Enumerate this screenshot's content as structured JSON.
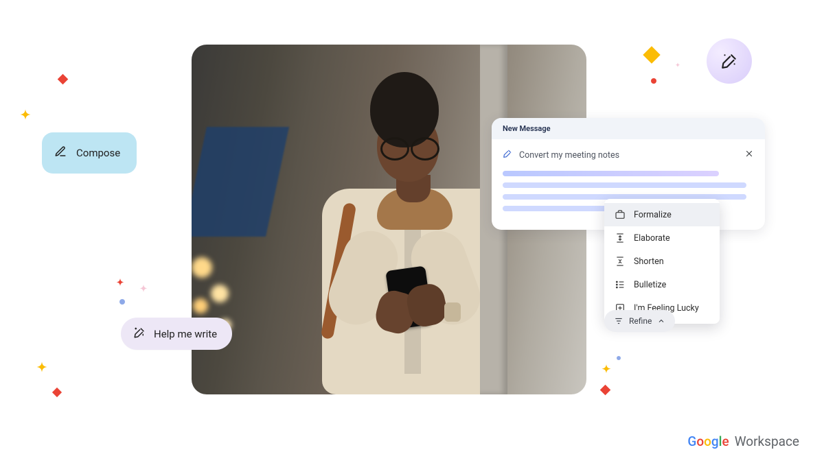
{
  "compose": {
    "label": "Compose"
  },
  "help_me_write": {
    "label": "Help me write"
  },
  "panel": {
    "title": "New Message",
    "prompt": "Convert my meeting notes"
  },
  "menu": {
    "items": [
      {
        "label": "Formalize"
      },
      {
        "label": "Elaborate"
      },
      {
        "label": "Shorten"
      },
      {
        "label": "Bulletize"
      },
      {
        "label": "I'm Feeling Lucky"
      }
    ]
  },
  "refine": {
    "label": "Refine"
  },
  "brand": {
    "google": "Google",
    "workspace": "Workspace"
  }
}
